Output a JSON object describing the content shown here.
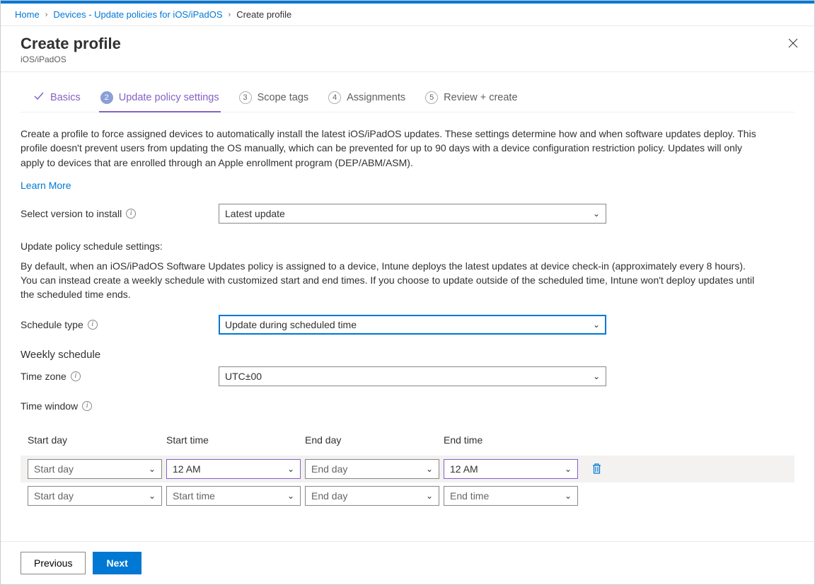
{
  "breadcrumb": {
    "home": "Home",
    "devices": "Devices - Update policies for iOS/iPadOS",
    "current": "Create profile"
  },
  "header": {
    "title": "Create profile",
    "subtitle": "iOS/iPadOS"
  },
  "tabs": {
    "basics": "Basics",
    "update": "Update policy settings",
    "scope": "Scope tags",
    "assignments": "Assignments",
    "review": "Review + create",
    "n2": "2",
    "n3": "3",
    "n4": "4",
    "n5": "5"
  },
  "body": {
    "intro": "Create a profile to force assigned devices to automatically install the latest iOS/iPadOS updates. These settings determine how and when software updates deploy. This profile doesn't prevent users from updating the OS manually, which can be prevented for up to 90 days with a device configuration restriction policy. Updates will only apply to devices that are enrolled through an Apple enrollment program (DEP/ABM/ASM).",
    "learn_more": "Learn More",
    "version_label": "Select version to install",
    "version_value": "Latest update",
    "schedule_heading": "Update policy schedule settings:",
    "schedule_desc": "By default, when an iOS/iPadOS Software Updates policy is assigned to a device, Intune deploys the latest updates at device check-in (approximately every 8 hours). You can instead create a weekly schedule with customized start and end times. If you choose to update outside of the scheduled time, Intune won't deploy updates until the scheduled time ends.",
    "schedule_type_label": "Schedule type",
    "schedule_type_value": "Update during scheduled time",
    "weekly_heading": "Weekly schedule",
    "timezone_label": "Time zone",
    "timezone_value": "UTC±00",
    "timewindow_label": "Time window"
  },
  "table": {
    "hdr_start_day": "Start day",
    "hdr_start_time": "Start time",
    "hdr_end_day": "End day",
    "hdr_end_time": "End time",
    "r1_start_day": "Start day",
    "r1_start_time": "12 AM",
    "r1_end_day": "End day",
    "r1_end_time": "12 AM",
    "r2_start_day": "Start day",
    "r2_start_time": "Start time",
    "r2_end_day": "End day",
    "r2_end_time": "End time"
  },
  "footer": {
    "previous": "Previous",
    "next": "Next"
  }
}
